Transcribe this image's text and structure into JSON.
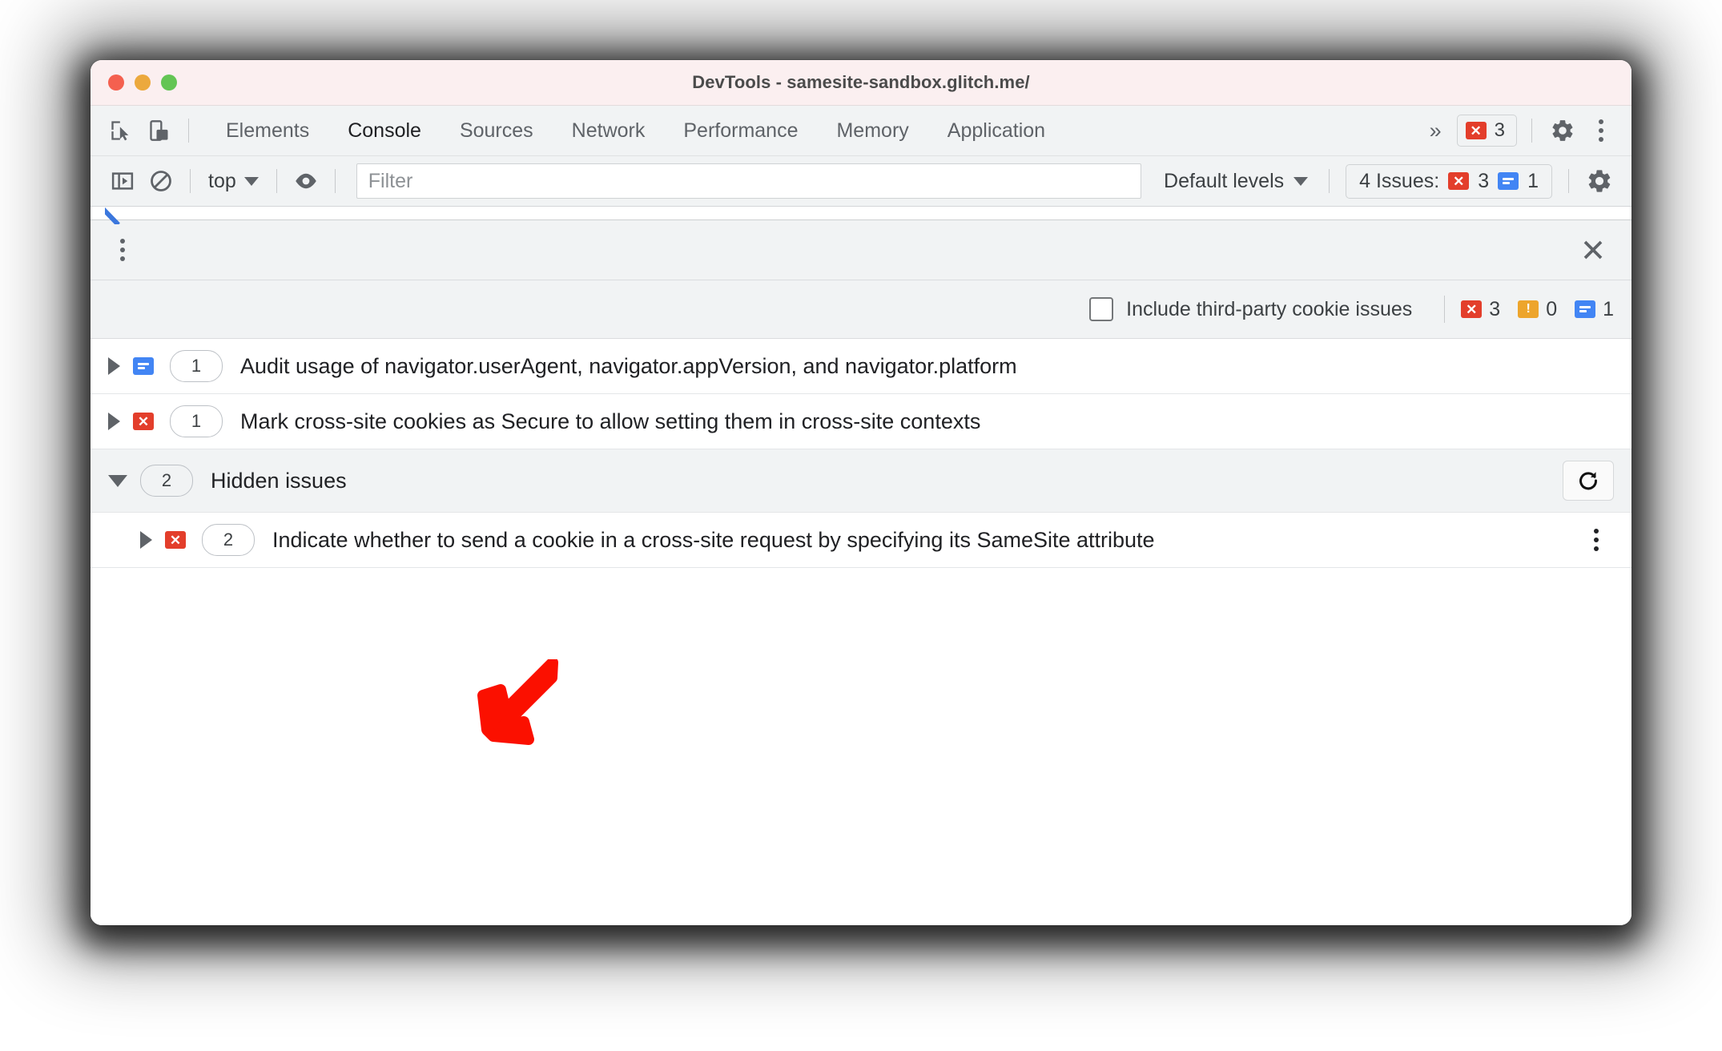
{
  "window": {
    "title": "DevTools - samesite-sandbox.glitch.me/",
    "traffic_lights": [
      "close",
      "minimize",
      "zoom"
    ],
    "colors": {
      "titlebar_bg": "#fbeff0",
      "toolbar_bg": "#f1f3f4",
      "error_red": "#e33e2b",
      "info_blue": "#4285f4",
      "warning_orange": "#eda52c",
      "annotation_red": "#fb1000",
      "accent_blue": "#3b77dd"
    }
  },
  "tabstrip": {
    "inspect_icon": "inspect-element-icon",
    "device_icon": "device-toolbar-icon",
    "tabs": [
      {
        "label": "Elements",
        "active": false
      },
      {
        "label": "Console",
        "active": true
      },
      {
        "label": "Sources",
        "active": false
      },
      {
        "label": "Network",
        "active": false
      },
      {
        "label": "Performance",
        "active": false
      },
      {
        "label": "Memory",
        "active": false
      },
      {
        "label": "Application",
        "active": false
      }
    ],
    "more_tabs": "»",
    "error_badge": {
      "icon": "error-bubble-icon",
      "count": "3"
    },
    "settings_icon": "gear-icon",
    "more_icon": "kebab-menu-icon"
  },
  "filterbar": {
    "sidebar_toggle_icon": "console-sidebar-icon",
    "clear_icon": "clear-console-icon",
    "context": "top",
    "eye_icon": "live-expression-icon",
    "filter_placeholder": "Filter",
    "filter_value": "",
    "levels": "Default levels",
    "issues_label": "4 Issues:",
    "issues_errors": "3",
    "issues_info": "1",
    "settings_icon": "gear-icon"
  },
  "drawer": {
    "menu_icon": "kebab-menu-icon",
    "close_icon": "close-icon",
    "cookie_checkbox_label": "Include third-party cookie issues",
    "cookie_checkbox_checked": false,
    "counts": [
      {
        "kind": "error",
        "value": "3"
      },
      {
        "kind": "warning",
        "value": "0"
      },
      {
        "kind": "info",
        "value": "1"
      }
    ],
    "issues": [
      {
        "kind": "info",
        "count": "1",
        "title": "Audit usage of navigator.userAgent, navigator.appVersion, and navigator.platform",
        "expanded": false,
        "nested": false
      },
      {
        "kind": "error",
        "count": "1",
        "title": "Mark cross-site cookies as Secure to allow setting them in cross-site contexts",
        "expanded": false,
        "nested": false
      }
    ],
    "hidden_group": {
      "count": "2",
      "label": "Hidden issues",
      "expanded": true,
      "refresh_icon": "refresh-icon"
    },
    "hidden_issues": [
      {
        "kind": "error",
        "count": "2",
        "title": "Indicate whether to send a cookie in a cross-site request by specifying its SameSite attribute",
        "expanded": false,
        "nested": true,
        "menu_icon": "kebab-menu-icon"
      }
    ]
  },
  "annotation": {
    "arrow_icon": "red-pointer-arrow",
    "points_at": "Hidden issues"
  }
}
